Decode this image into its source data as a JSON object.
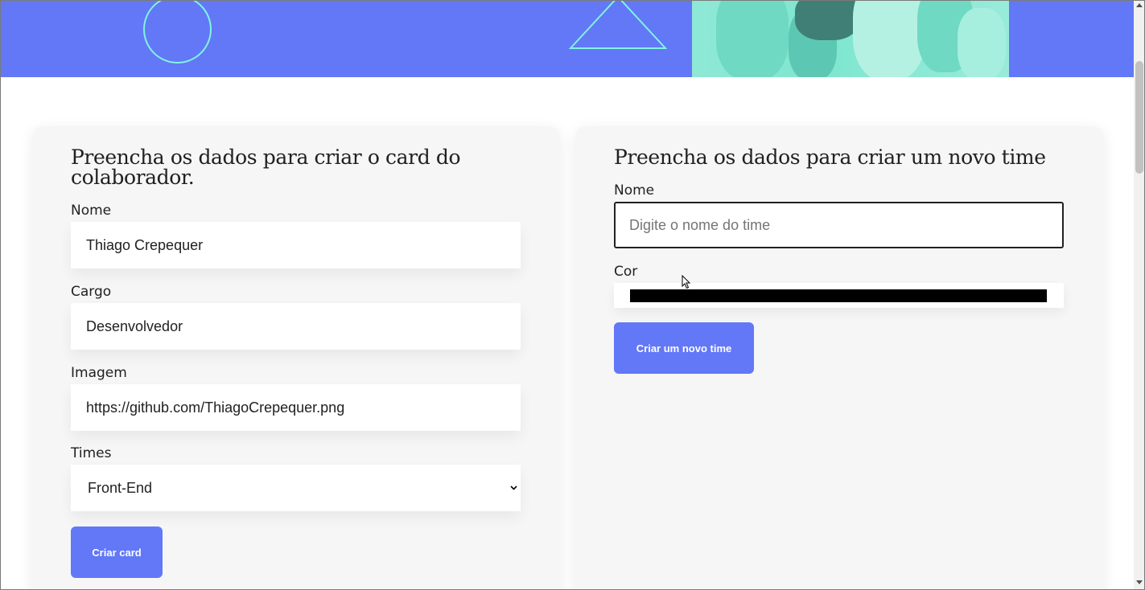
{
  "colors": {
    "brand": "#6278f7",
    "accent": "#7ff4e0",
    "panel_bg": "#f6f6f6",
    "team_color_value": "#000000"
  },
  "collaborator_form": {
    "title": "Preencha os dados para criar o card do colaborador.",
    "name_label": "Nome",
    "name_value": "Thiago Crepequer",
    "role_label": "Cargo",
    "role_value": "Desenvolvedor",
    "image_label": "Imagem",
    "image_value": "https://github.com/ThiagoCrepequer.png",
    "teams_label": "Times",
    "teams_selected": "Front-End",
    "submit_label": "Criar card"
  },
  "team_form": {
    "title": "Preencha os dados para criar um novo time",
    "name_label": "Nome",
    "name_placeholder": "Digite o nome do time",
    "color_label": "Cor",
    "submit_label": "Criar um novo time"
  },
  "icons": {
    "select_chevron": "chevron-down-icon",
    "banner_circle": "circle-shape",
    "banner_triangle": "triangle-shape"
  }
}
